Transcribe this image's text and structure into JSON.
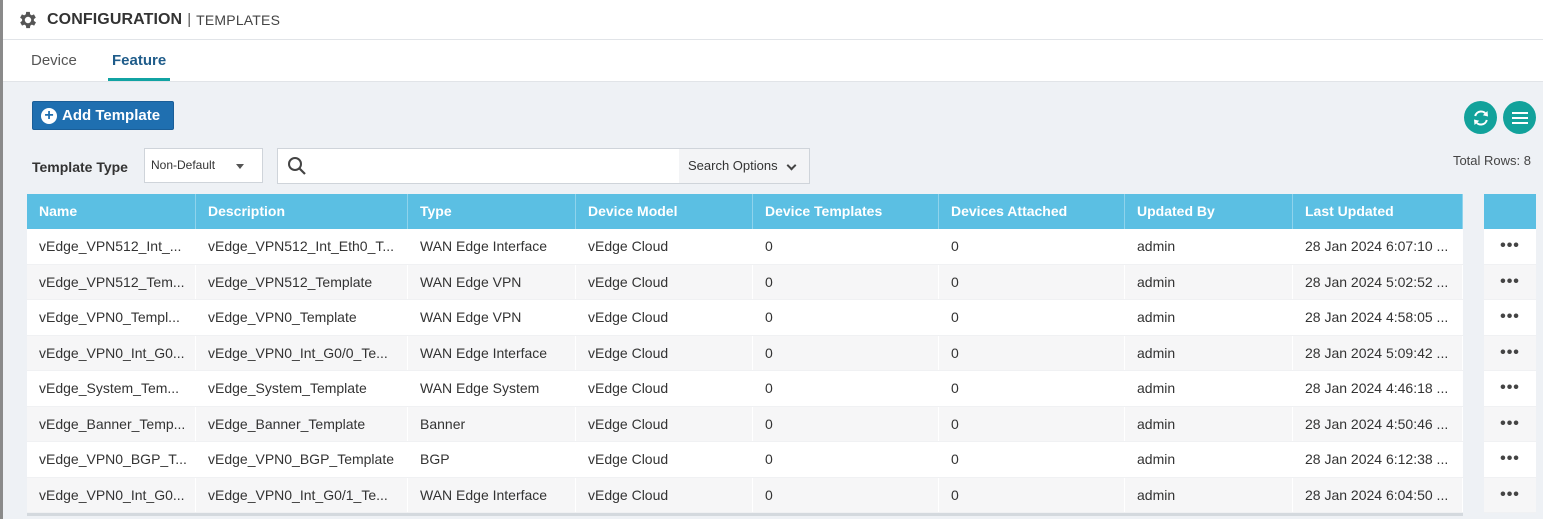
{
  "header": {
    "title": "CONFIGURATION",
    "separator": "|",
    "subtitle": "TEMPLATES"
  },
  "tabs": [
    {
      "label": "Device"
    },
    {
      "label": "Feature",
      "active": true
    }
  ],
  "toolbar": {
    "add_label": "Add Template",
    "refresh_icon": "refresh-icon",
    "menu_icon": "menu-icon"
  },
  "filter": {
    "template_type_label": "Template Type",
    "template_type_value": "Non-Default",
    "search_placeholder": "",
    "search_options_label": "Search Options"
  },
  "total_rows": "Total Rows: 8",
  "table": {
    "columns": [
      "Name",
      "Description",
      "Type",
      "Device Model",
      "Device Templates",
      "Devices Attached",
      "Updated By",
      "Last Updated"
    ],
    "rows": [
      [
        "vEdge_VPN512_Int_...",
        "vEdge_VPN512_Int_Eth0_T...",
        "WAN Edge Interface",
        "vEdge Cloud",
        "0",
        "0",
        "admin",
        "28 Jan 2024 6:07:10 ..."
      ],
      [
        "vEdge_VPN512_Tem...",
        "vEdge_VPN512_Template",
        "WAN Edge VPN",
        "vEdge Cloud",
        "0",
        "0",
        "admin",
        "28 Jan 2024 5:02:52 ..."
      ],
      [
        "vEdge_VPN0_Templ...",
        "vEdge_VPN0_Template",
        "WAN Edge VPN",
        "vEdge Cloud",
        "0",
        "0",
        "admin",
        "28 Jan 2024 4:58:05 ..."
      ],
      [
        "vEdge_VPN0_Int_G0...",
        "vEdge_VPN0_Int_G0/0_Te...",
        "WAN Edge Interface",
        "vEdge Cloud",
        "0",
        "0",
        "admin",
        "28 Jan 2024 5:09:42 ..."
      ],
      [
        "vEdge_System_Tem...",
        "vEdge_System_Template",
        "WAN Edge System",
        "vEdge Cloud",
        "0",
        "0",
        "admin",
        "28 Jan 2024 4:46:18 ..."
      ],
      [
        "vEdge_Banner_Temp...",
        "vEdge_Banner_Template",
        "Banner",
        "vEdge Cloud",
        "0",
        "0",
        "admin",
        "28 Jan 2024 4:50:46 ..."
      ],
      [
        "vEdge_VPN0_BGP_T...",
        "vEdge_VPN0_BGP_Template",
        "BGP",
        "vEdge Cloud",
        "0",
        "0",
        "admin",
        "28 Jan 2024 6:12:38 ..."
      ],
      [
        "vEdge_VPN0_Int_G0...",
        "vEdge_VPN0_Int_G0/1_Te...",
        "WAN Edge Interface",
        "vEdge Cloud",
        "0",
        "0",
        "admin",
        "28 Jan 2024 6:04:50 ..."
      ]
    ],
    "row_action": "•••"
  },
  "colors": {
    "header_bg": "#5bbfe3",
    "primary": "#1f6fb0",
    "accent": "#12a29b",
    "tab_underline": "#11a3a3"
  }
}
